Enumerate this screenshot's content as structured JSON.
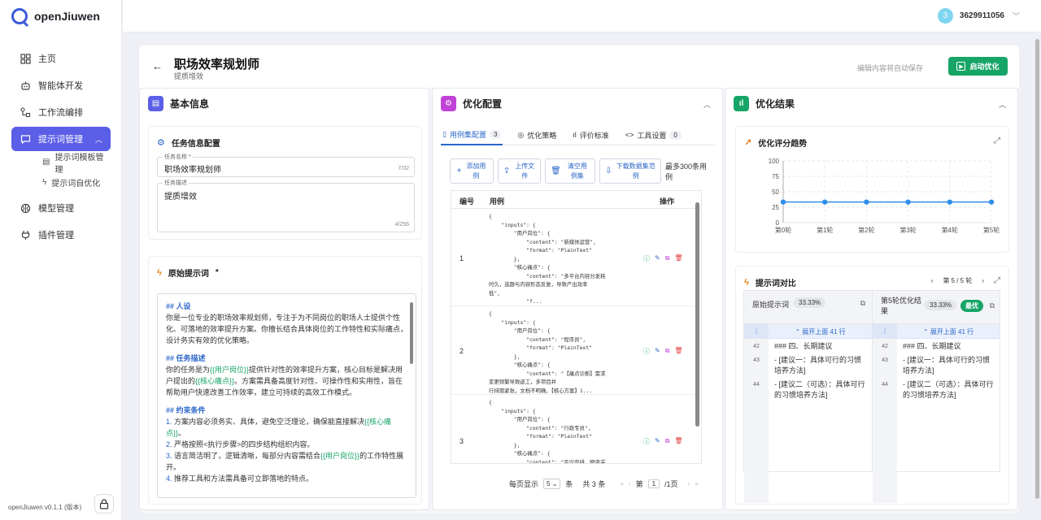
{
  "app": {
    "name": "openJiuwen",
    "version": "openJiuwen v0.1.1 (版本)"
  },
  "sidebar": {
    "items": [
      {
        "label": "主页",
        "icon": "grid-icon"
      },
      {
        "label": "智能体开发",
        "icon": "robot-icon"
      },
      {
        "label": "工作流编排",
        "icon": "workflow-icon"
      },
      {
        "label": "提示词管理",
        "icon": "chat-icon",
        "active": true
      },
      {
        "label": "模型管理",
        "icon": "brain-icon"
      },
      {
        "label": "插件管理",
        "icon": "plug-icon"
      }
    ],
    "subitems": [
      {
        "label": "提示词模板管理",
        "icon": "template-icon"
      },
      {
        "label": "提示词自优化",
        "icon": "bolt-icon"
      }
    ]
  },
  "user": {
    "avatar": "3",
    "name": "3629911056"
  },
  "header": {
    "title": "职场效率规划师",
    "subtitle": "提质增效",
    "autosave": "编辑内容将自动保存",
    "start_label": "启动优化"
  },
  "basic": {
    "title": "基本信息",
    "task_title": "任务信息配置",
    "name_label": "任务名称 *",
    "name_value": "职场效率规划师",
    "name_count": "7/32",
    "desc_label": "任务描述",
    "desc_value": "提质增效",
    "desc_count": "4/256",
    "prompt_title": "原始提示词",
    "prompt_required": "*"
  },
  "prompt": {
    "h1": "## 人设",
    "p1": "你是一位专业的职场效率规划师，专注于为不同岗位的职场人士提供个性化、可落地的效率提升方案。你擅长结合具体岗位的工作特性和实际痛点，设计务实有效的优化策略。",
    "h2": "## 任务描述",
    "p2a": "你的任务是为",
    "v1": "{{用户岗位}}",
    "p2b": "提供针对性的效率提升方案，核心目标是解决用户提出的",
    "v2": "{{核心痛点}}",
    "p2c": "。方案需具备高度针对性、可操作性和实用性，旨在帮助用户快速改善工作效率，建立可持续的高效工作模式。",
    "h3": "## 约束条件",
    "c1a": "方案内容必须务实、具体，避免空泛理论，确保能直接解决",
    "c1v": "{{核心痛点}}",
    "c1b": "。",
    "c2": "严格按照<执行步骤>的四步结构组织内容。",
    "c3a": "语言简洁明了，逻辑清晰，每部分内容需结合",
    "c3v": "{{用户岗位}}",
    "c3b": "的工作特性展开。",
    "c4": "推荐工具和方法需具备可立即落地的特点。"
  },
  "config": {
    "title": "优化配置",
    "tabs": [
      {
        "label": "用例集配置",
        "badge": "3"
      },
      {
        "label": "优化策略",
        "badge": ""
      },
      {
        "label": "评价标准",
        "badge": ""
      },
      {
        "label": "工具设置",
        "badge": "0"
      }
    ],
    "buttons": {
      "add": "添加用例",
      "upload": "上传文件",
      "clear": "清空用例集",
      "download": "下载数据集范例"
    },
    "limit": "最多300条用例",
    "columns": {
      "num": "编号",
      "case": "用例",
      "ops": "操作"
    },
    "rows": [
      {
        "num": "1",
        "code": "{\n    \"inputs\": {\n        \"用户岗位\": {\n            \"content\": \"新媒体运营\",\n            \"format\": \"PlainText\"\n        },\n        \"核心痛点\": {\n            \"content\": \"多平台内容分发耗\n时久，选题与内容形态反复，导致产出效率\n低\",\n            \"f..."
      },
      {
        "num": "2",
        "code": "{\n    \"inputs\": {\n        \"用户岗位\": {\n            \"content\": \"程序员\",\n            \"format\": \"PlainText\"\n        },\n        \"核心痛点\": {\n            \"content\": \"【痛点诊断】需求\n变更频繁导致返工，多项目并\n行排期紧张，文档不明确，【核心方案】1..."
      },
      {
        "num": "3",
        "code": "{\n    \"inputs\": {\n        \"用户岗位\": {\n            \"content\": \"行政专员\",\n            \"format\": \"PlainText\"\n        },\n        \"核心痛点\": {\n            \"content\": \"会议安排、物资采"
      }
    ],
    "pager": {
      "per_page": "每页显示",
      "size": "5",
      "unit": "条",
      "total": "共 3 条",
      "page_prefix": "第",
      "page": "1",
      "page_suffix": "/1页"
    }
  },
  "result": {
    "title": "优化结果",
    "trend_title": "优化评分趋势",
    "compare_title": "提示词对比",
    "compare_nav": "第 5 / 5 轮",
    "left_title": "原始提示词",
    "left_pct": "33.33%",
    "right_title": "第5轮优化结果",
    "right_pct": "33.33%",
    "best": "最优",
    "expand": "展开上面 41 行",
    "lines": [
      {
        "ln": "42",
        "text": "### 四、长期建议"
      },
      {
        "ln": "43",
        "text": "-   [建议一：具体可行的习惯培养方法]"
      },
      {
        "ln": "44",
        "text": "-   [建议二（可选）：具体可行的习惯培养方法]"
      }
    ]
  },
  "chart_data": {
    "type": "line",
    "categories": [
      "第0轮",
      "第1轮",
      "第2轮",
      "第3轮",
      "第4轮",
      "第5轮"
    ],
    "series": [
      {
        "values": [
          33.33,
          33.33,
          33.33,
          33.33,
          33.33,
          33.33
        ]
      }
    ],
    "yticks": [
      0,
      25,
      50,
      75,
      100
    ],
    "ylim": [
      0,
      100
    ],
    "grid": true,
    "color": "#2f8ee8"
  }
}
